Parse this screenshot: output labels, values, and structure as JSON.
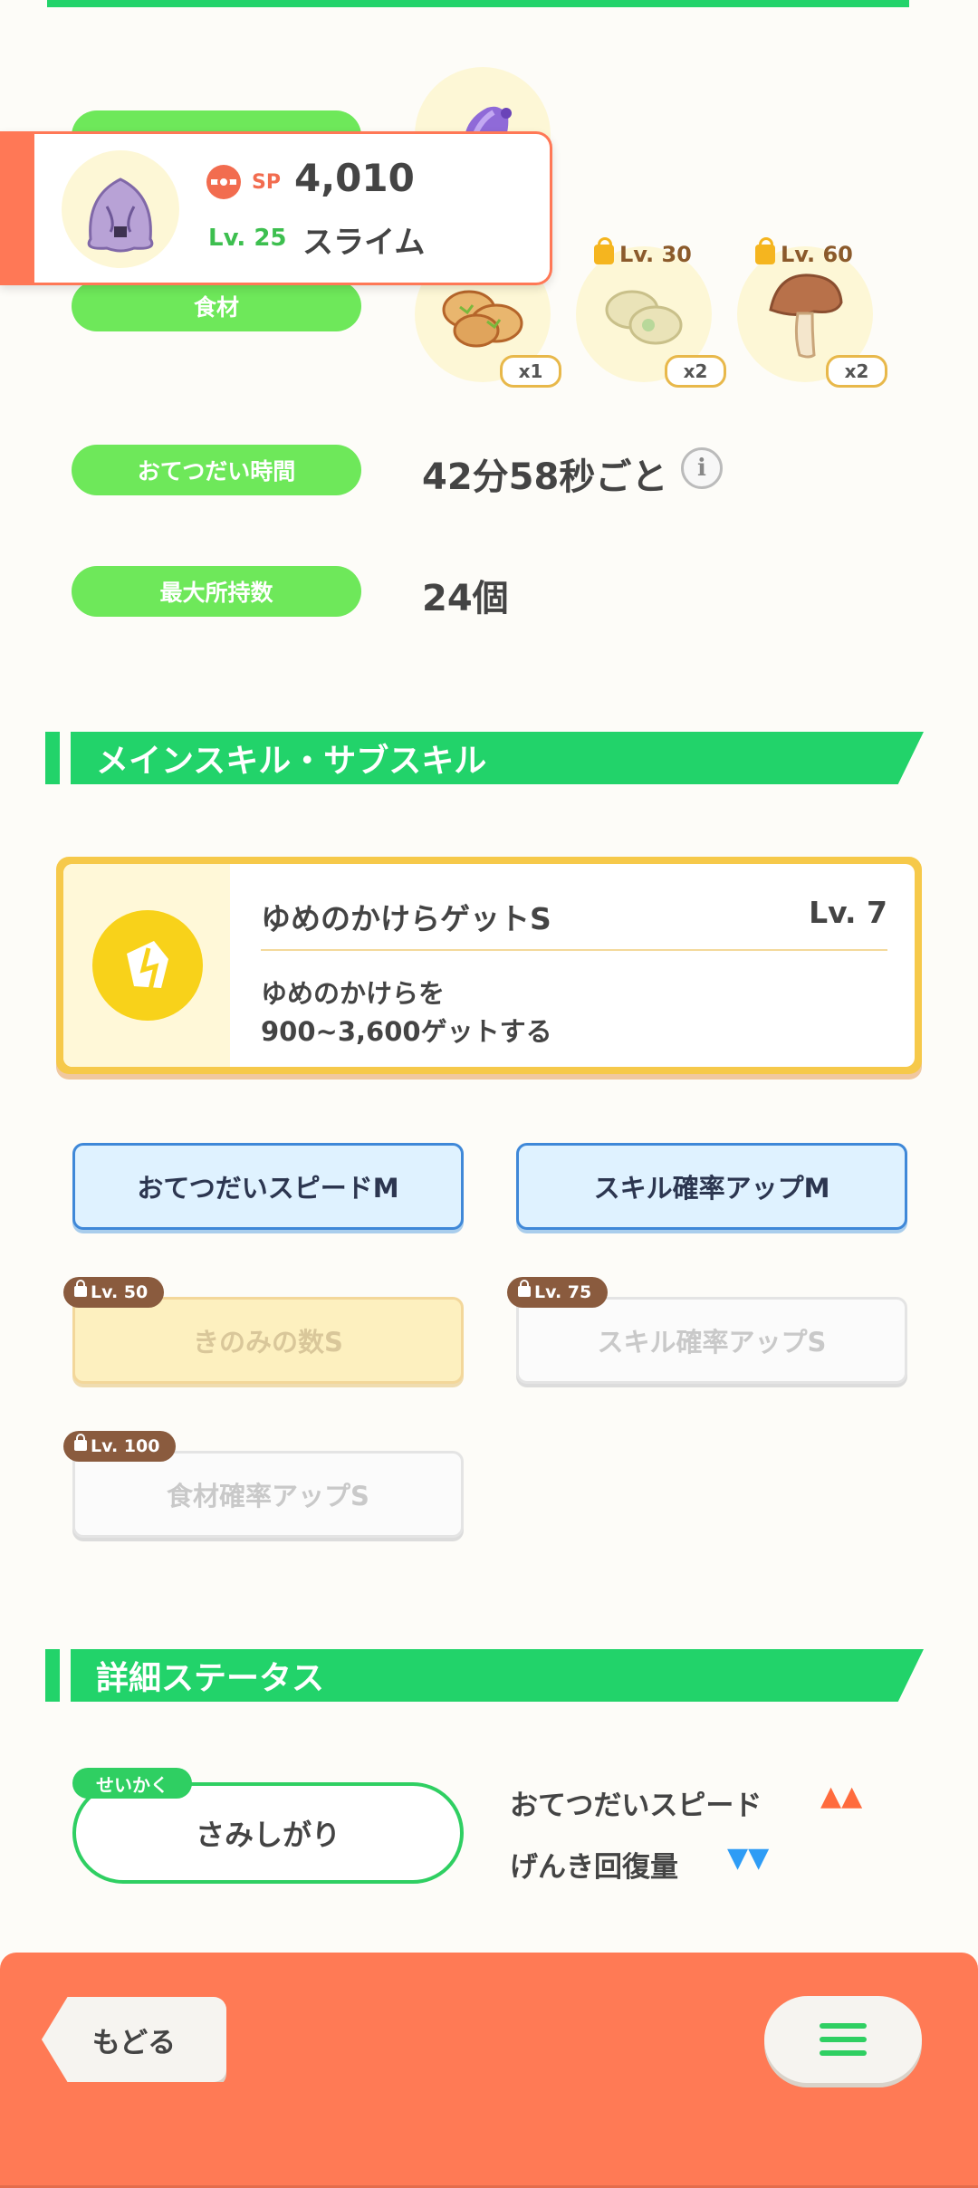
{
  "ingredients": {
    "label": "食材",
    "items": [
      {
        "name": "mushroom-ingredient",
        "qty": "x1",
        "unlock": ""
      },
      {
        "name": "bean-ingredient",
        "qty": "x2",
        "unlock": "Lv. 30"
      },
      {
        "name": "mushroom-ingredient",
        "qty": "x2",
        "unlock": "Lv. 60"
      }
    ]
  },
  "popup": {
    "sp_label": "SP",
    "sp_value": "4,010",
    "level": "Lv. 25",
    "name": "スライム"
  },
  "info": {
    "help_time_label": "おてつだい時間",
    "help_time_value": "42分58秒ごと",
    "max_carry_label": "最大所持数",
    "max_carry_value": "24個"
  },
  "skills_section": {
    "title": "メインスキル・サブスキル",
    "main_skill": {
      "name": "ゆめのかけらゲットS",
      "level": "Lv. 7",
      "description_line1": "ゆめのかけらを",
      "description_line2": "900~3,600ゲットする"
    },
    "sub_skills": [
      {
        "label": "おてつだいスピードM",
        "lock": ""
      },
      {
        "label": "スキル確率アップM",
        "lock": ""
      },
      {
        "label": "きのみの数S",
        "lock": "Lv. 50"
      },
      {
        "label": "スキル確率アップS",
        "lock": "Lv. 75"
      },
      {
        "label": "食材確率アップS",
        "lock": "Lv. 100"
      }
    ]
  },
  "details": {
    "title": "詳細ステータス",
    "nature_tag": "せいかく",
    "nature": "さみしがり",
    "stat_up_label": "おてつだいスピード",
    "stat_up_marks": "▲▲",
    "stat_down_label": "げんき回復量",
    "stat_down_marks": "▼▼"
  },
  "bottom": {
    "back_label": "もどる"
  },
  "colors": {
    "accent_green": "#22d36a",
    "pill_green": "#6ee85a",
    "orange": "#ff7a55",
    "up": "#ff6b3d",
    "down": "#2e9cf5"
  }
}
